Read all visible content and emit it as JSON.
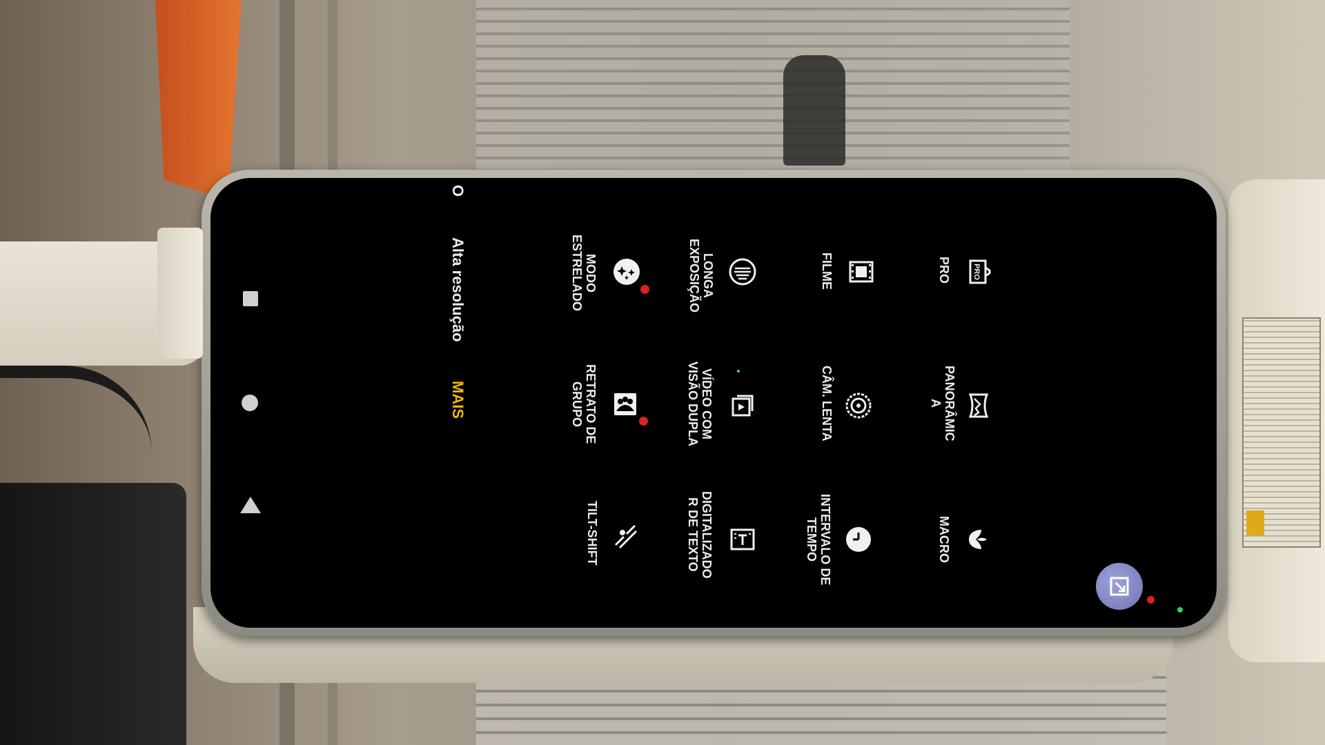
{
  "modes_bar": {
    "tabs": [
      {
        "label": "Alta resolução",
        "active": false
      },
      {
        "label": "MAIS",
        "active": true
      }
    ],
    "partial_label": "O"
  },
  "more_modes": [
    {
      "label": "PRO",
      "icon": "pro-icon",
      "badge": false
    },
    {
      "label": "PANORÂMIC\nA",
      "icon": "panorama-icon",
      "badge": false
    },
    {
      "label": "MACRO",
      "icon": "macro-flower-icon",
      "badge": false
    },
    {
      "label": "FILME",
      "icon": "film-icon",
      "badge": false
    },
    {
      "label": "CÂM. LENTA",
      "icon": "slow-motion-icon",
      "badge": false
    },
    {
      "label": "INTERVALO DE\nTEMPO",
      "icon": "time-lapse-icon",
      "badge": false
    },
    {
      "label": "LONGA\nEXPOSIÇÃO",
      "icon": "long-exposure-icon",
      "badge": false
    },
    {
      "label": "VÍDEO COM\nVISÃO DUPLA",
      "icon": "dual-view-video-icon",
      "badge": false
    },
    {
      "label": "DIGITALIZADO\nR DE TEXTO",
      "icon": "text-scanner-icon",
      "badge": false
    },
    {
      "label": "MODO\nESTRELADO",
      "icon": "starry-mode-icon",
      "badge": true
    },
    {
      "label": "RETRATO DE\nGRUPO",
      "icon": "group-portrait-icon",
      "badge": true
    },
    {
      "label": "TILT-SHIFT",
      "icon": "tilt-shift-icon",
      "badge": false
    }
  ],
  "nav": {
    "recent": "recent-apps-icon",
    "home": "home-icon",
    "back": "back-icon"
  },
  "colors": {
    "accent": "#f5b800",
    "badge": "#e02020",
    "screen": "#000000",
    "float_button": "#8286c8"
  }
}
